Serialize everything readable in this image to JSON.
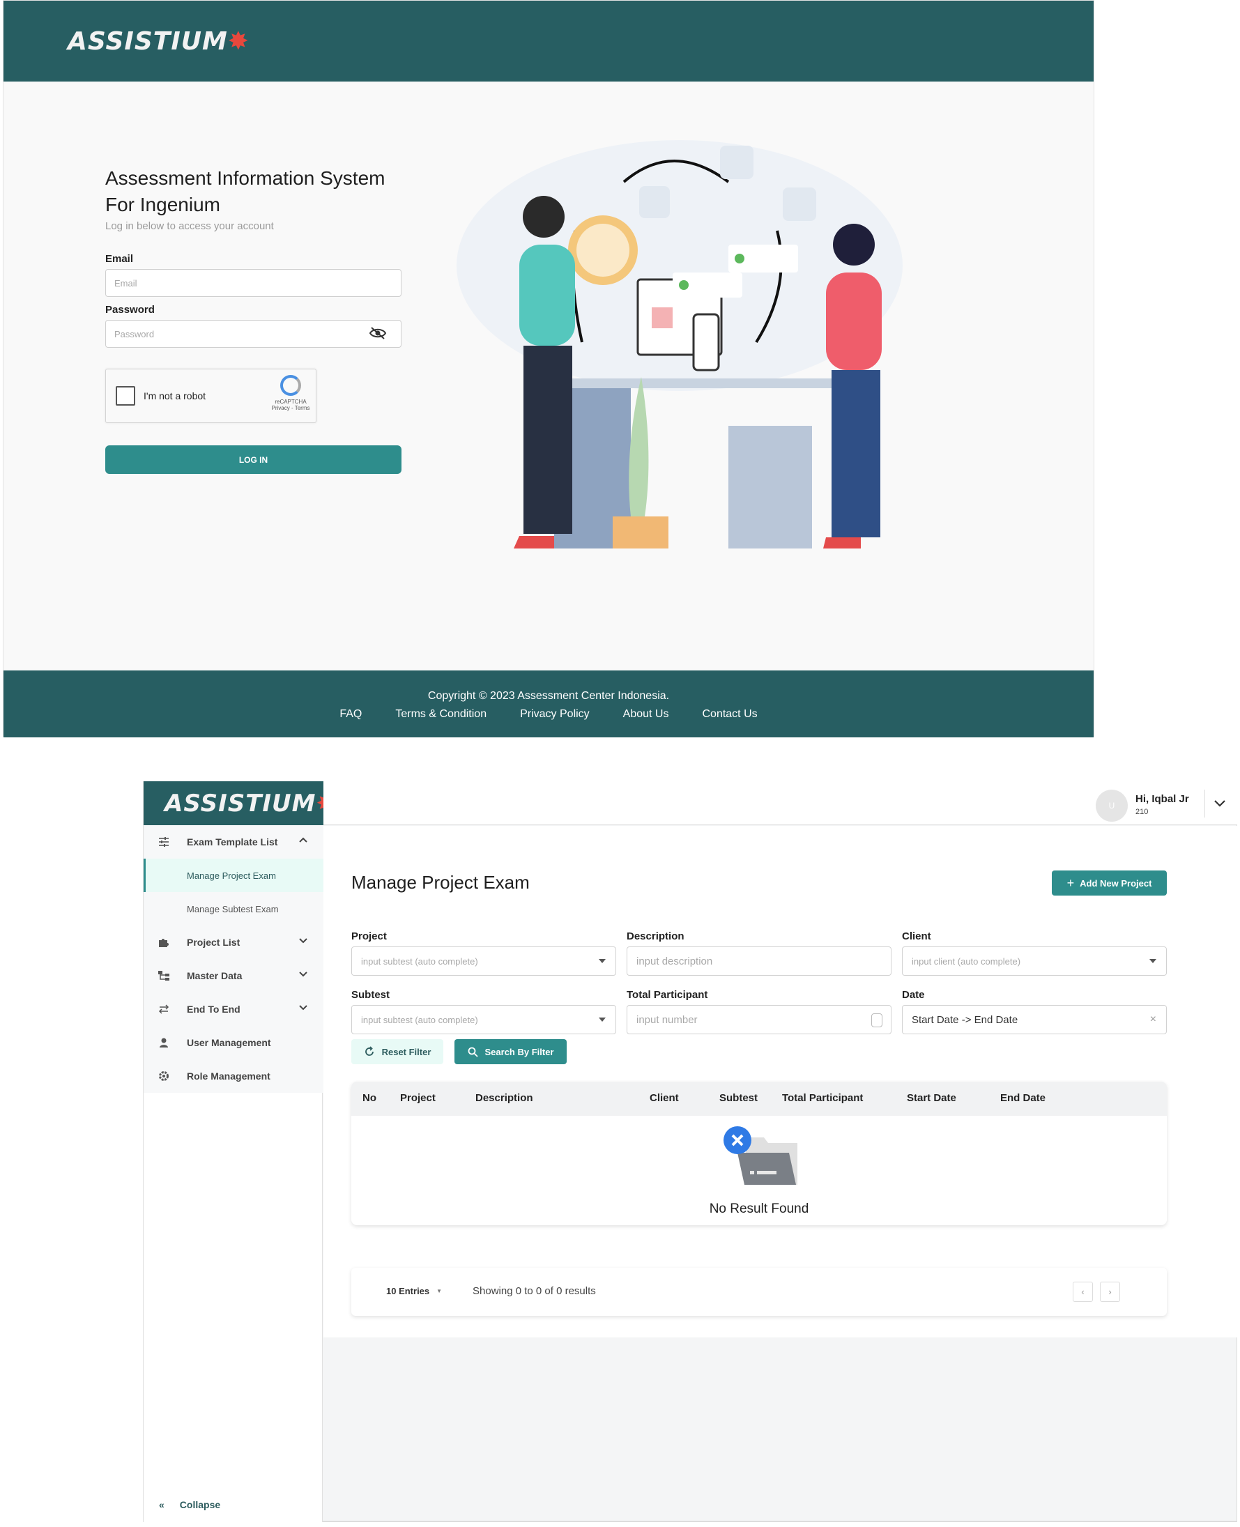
{
  "login": {
    "logo_text": "ASSISTIUM",
    "heading": "Assessment Information System For Ingenium",
    "subtitle": "Log in below to access your account",
    "email_label": "Email",
    "email_placeholder": "Email",
    "password_label": "Password",
    "password_placeholder": "Password",
    "captcha_text": "I'm not a robot",
    "captcha_brand": "reCAPTCHA",
    "captcha_links": "Privacy - Terms",
    "login_button": "LOG IN",
    "footer": {
      "copyright": "Copyright © 2023 Assessment Center Indonesia.",
      "links": [
        "FAQ",
        "Terms & Condition",
        "Privacy Policy",
        "About Us",
        "Contact Us"
      ]
    },
    "colors": {
      "brand": "#275e62",
      "accent": "#2e8d8c"
    }
  },
  "dashboard": {
    "logo_text": "ASSISTIUM",
    "user": {
      "avatar": "U",
      "greeting": "Hi, Iqbal Jr",
      "id": "210"
    },
    "sidebar": {
      "items": [
        {
          "label": "Exam Template List",
          "icon": "sliders-icon"
        },
        {
          "label": "Project List",
          "icon": "puzzle-icon"
        },
        {
          "label": "Master Data",
          "icon": "hierarchy-icon"
        },
        {
          "label": "End To End",
          "icon": "swap-icon"
        },
        {
          "label": "User Management",
          "icon": "person-icon"
        },
        {
          "label": "Role Management",
          "icon": "gear-icon"
        }
      ],
      "subitems": [
        "Manage Project Exam",
        "Manage Subtest Exam"
      ],
      "collapse": "Collapse"
    },
    "page_title": "Manage Project Exam",
    "add_button": "Add New Project",
    "filters": {
      "project_label": "Project",
      "project_placeholder": "input subtest (auto complete)",
      "description_label": "Description",
      "description_placeholder": "input description",
      "client_label": "Client",
      "client_placeholder": "input client (auto complete)",
      "subtest_label": "Subtest",
      "subtest_placeholder": "input subtest (auto complete)",
      "participant_label": "Total Participant",
      "participant_placeholder": "input number",
      "date_label": "Date",
      "date_value": "Start Date -> End Date",
      "reset": "Reset Filter",
      "search": "Search By Filter"
    },
    "table": {
      "headers": [
        "No",
        "Project",
        "Description",
        "Client",
        "Subtest",
        "Total Participant",
        "Start Date",
        "End Date"
      ],
      "empty": "No Result Found"
    },
    "pagination": {
      "entries": "10 Entries",
      "showing": "Showing 0 to 0 of 0 results",
      "prev": "‹",
      "next": "›"
    }
  }
}
